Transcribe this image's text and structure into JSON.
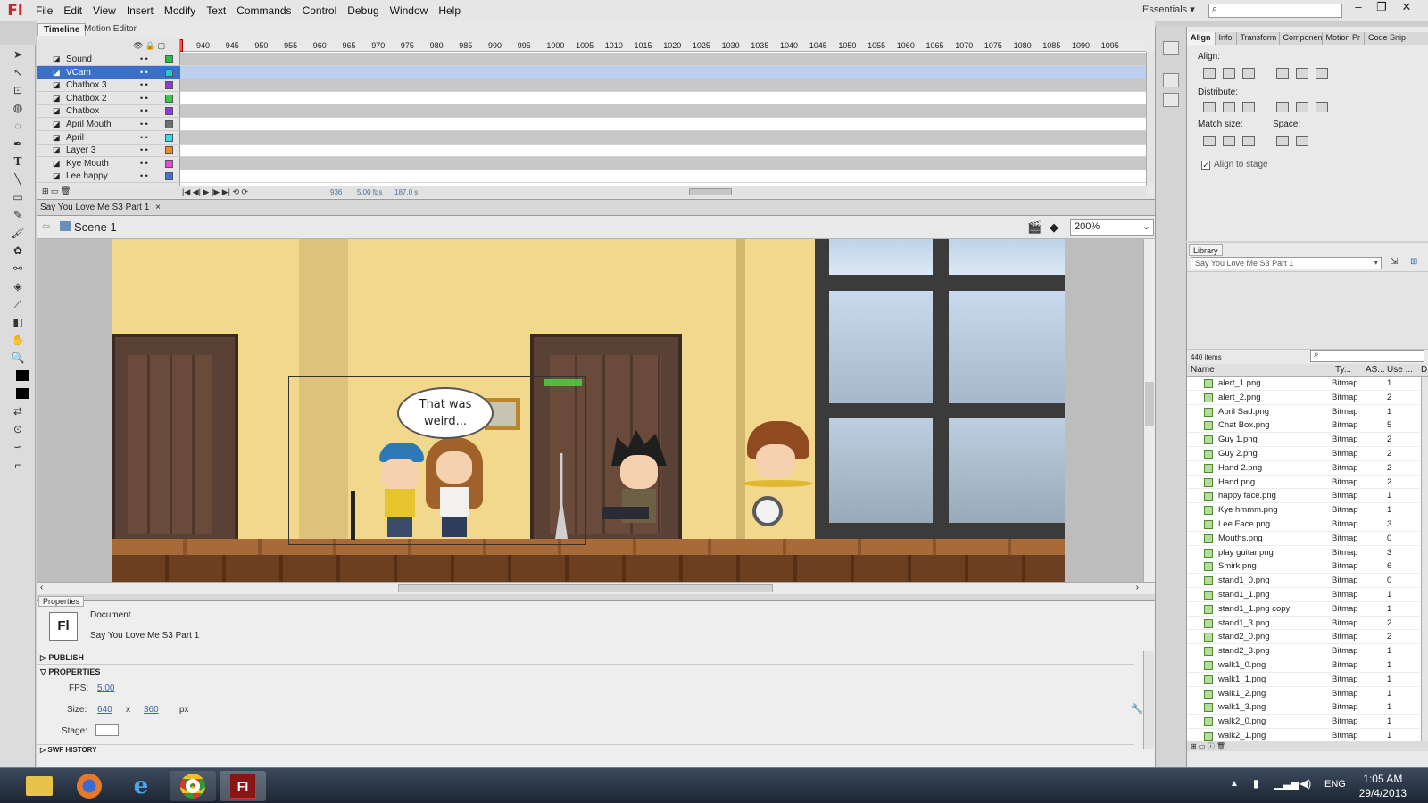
{
  "app": {
    "logo": "Fl"
  },
  "menu": [
    "File",
    "Edit",
    "View",
    "Insert",
    "Modify",
    "Text",
    "Commands",
    "Control",
    "Debug",
    "Window",
    "Help"
  ],
  "workspace": {
    "label": "Essentials",
    "arrow": "▾"
  },
  "timeline": {
    "tabs": [
      "Timeline",
      "Motion Editor"
    ],
    "ruler": [
      "940",
      "945",
      "950",
      "955",
      "960",
      "965",
      "970",
      "975",
      "980",
      "985",
      "990",
      "995",
      "1000",
      "1005",
      "1010",
      "1015",
      "1020",
      "1025",
      "1030",
      "1035",
      "1040",
      "1045",
      "1050",
      "1055",
      "1060",
      "1065",
      "1070",
      "1075",
      "1080",
      "1085",
      "1090",
      "1095"
    ],
    "layers": [
      {
        "name": "Sound",
        "color": "#22c14a"
      },
      {
        "name": "VCam",
        "color": "#27c9c9"
      },
      {
        "name": "Chatbox 3",
        "color": "#8f3ad6"
      },
      {
        "name": "Chatbox 2",
        "color": "#39c84a"
      },
      {
        "name": "Chatbox",
        "color": "#8f3ad6"
      },
      {
        "name": "April Mouth",
        "color": "#6f6f6f"
      },
      {
        "name": "April",
        "color": "#35dde8"
      },
      {
        "name": "Layer 3",
        "color": "#f28a26"
      },
      {
        "name": "Kye Mouth",
        "color": "#e84ad6"
      },
      {
        "name": "Lee happy",
        "color": "#3d74d6"
      }
    ],
    "status": {
      "frame": "936",
      "fps": "5.00 fps",
      "time": "187.0 s"
    }
  },
  "document": {
    "tab": "Say You Love Me S3 Part 1",
    "close": "×",
    "scene": "Scene 1",
    "zoom": "200%"
  },
  "stage": {
    "bubble_text": "That was weird..."
  },
  "properties": {
    "tab": "Properties",
    "doc_type": "Document",
    "doc_name": "Say You Love Me S3 Part 1",
    "doc_icon": "Fl",
    "sections": {
      "publish": "PUBLISH",
      "properties": "PROPERTIES",
      "swf_history": "SWF HISTORY"
    },
    "fps_label": "FPS:",
    "fps": "5.00",
    "size_label": "Size:",
    "width": "640",
    "x": "x",
    "height": "360",
    "unit": "px",
    "stage_label": "Stage:"
  },
  "align_panel": {
    "tabs": [
      "Align",
      "Info",
      "Transform",
      "Componen",
      "Motion Pr",
      "Code Snip"
    ],
    "align_label": "Align:",
    "distribute_label": "Distribute:",
    "match_label": "Match size:",
    "space_label": "Space:",
    "align_to_stage": "Align to stage"
  },
  "library": {
    "tab": "Library",
    "dropdown": "Say You Love Me S3 Part 1",
    "count": "440 items",
    "columns": {
      "name": "Name",
      "type": "Ty...",
      "as": "AS...",
      "use": "Use ...",
      "d": "D"
    },
    "items": [
      {
        "name": "alert_1.png",
        "type": "Bitmap",
        "use": "1"
      },
      {
        "name": "alert_2.png",
        "type": "Bitmap",
        "use": "2"
      },
      {
        "name": "April Sad.png",
        "type": "Bitmap",
        "use": "1"
      },
      {
        "name": "Chat Box.png",
        "type": "Bitmap",
        "use": "5"
      },
      {
        "name": "Guy 1.png",
        "type": "Bitmap",
        "use": "2"
      },
      {
        "name": "Guy 2.png",
        "type": "Bitmap",
        "use": "2"
      },
      {
        "name": "Hand 2.png",
        "type": "Bitmap",
        "use": "2"
      },
      {
        "name": "Hand.png",
        "type": "Bitmap",
        "use": "2"
      },
      {
        "name": "happy face.png",
        "type": "Bitmap",
        "use": "1"
      },
      {
        "name": "Kye hmmm.png",
        "type": "Bitmap",
        "use": "1"
      },
      {
        "name": "Lee Face.png",
        "type": "Bitmap",
        "use": "3"
      },
      {
        "name": "Mouths.png",
        "type": "Bitmap",
        "use": "0"
      },
      {
        "name": "play guitar.png",
        "type": "Bitmap",
        "use": "3"
      },
      {
        "name": "Smirk.png",
        "type": "Bitmap",
        "use": "6"
      },
      {
        "name": "stand1_0.png",
        "type": "Bitmap",
        "use": "0"
      },
      {
        "name": "stand1_1.png",
        "type": "Bitmap",
        "use": "1"
      },
      {
        "name": "stand1_1.png copy",
        "type": "Bitmap",
        "use": "1"
      },
      {
        "name": "stand1_3.png",
        "type": "Bitmap",
        "use": "2"
      },
      {
        "name": "stand2_0.png",
        "type": "Bitmap",
        "use": "2"
      },
      {
        "name": "stand2_3.png",
        "type": "Bitmap",
        "use": "1"
      },
      {
        "name": "walk1_0.png",
        "type": "Bitmap",
        "use": "1"
      },
      {
        "name": "walk1_1.png",
        "type": "Bitmap",
        "use": "1"
      },
      {
        "name": "walk1_2.png",
        "type": "Bitmap",
        "use": "1"
      },
      {
        "name": "walk1_3.png",
        "type": "Bitmap",
        "use": "1"
      },
      {
        "name": "walk2_0.png",
        "type": "Bitmap",
        "use": "1"
      },
      {
        "name": "walk2_1.png",
        "type": "Bitmap",
        "use": "1"
      }
    ]
  },
  "taskbar": {
    "time": "1:05 AM",
    "date": "29/4/2013",
    "lang": "ENG",
    "flash_label": "Fl"
  }
}
